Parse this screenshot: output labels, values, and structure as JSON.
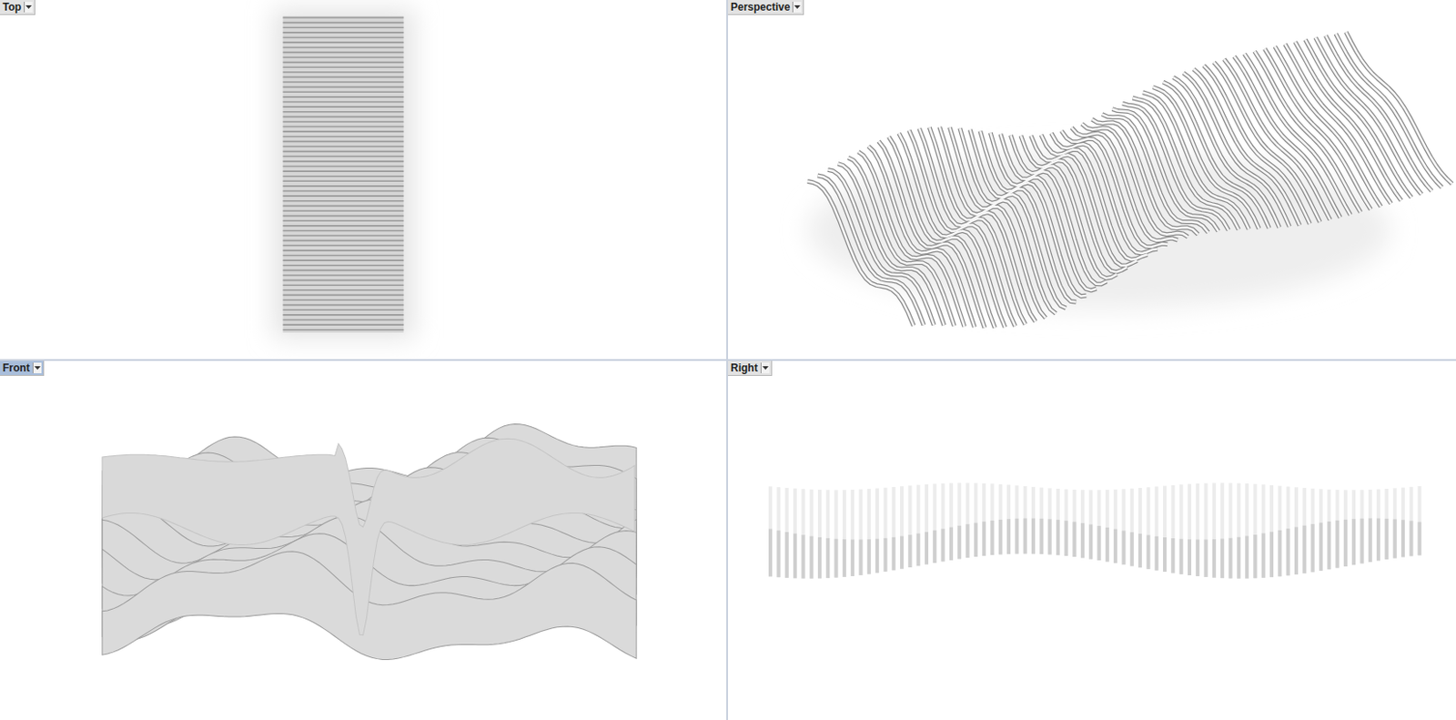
{
  "viewports": [
    {
      "label": "Top",
      "selected": false
    },
    {
      "label": "Perspective",
      "selected": false
    },
    {
      "label": "Front",
      "selected": true
    },
    {
      "label": "Right",
      "selected": false
    }
  ]
}
